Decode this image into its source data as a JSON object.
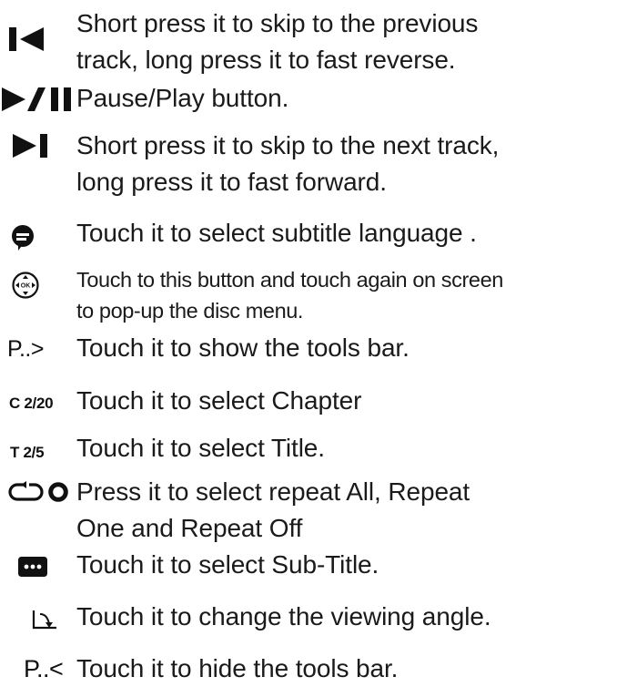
{
  "items": [
    {
      "icon": "skip-previous-icon",
      "lines": [
        "Short press it to skip to the previous",
        "track, long press it to fast reverse."
      ]
    },
    {
      "icon": "play-pause-icon",
      "lines": [
        "Pause/Play button."
      ]
    },
    {
      "icon": "skip-next-icon",
      "lines": [
        "Short press it to skip to the next track,",
        "long press it to fast forward."
      ]
    },
    {
      "icon": "subtitle-language-icon",
      "lines": [
        "Touch it to select subtitle language ."
      ]
    },
    {
      "icon": "disc-menu-icon",
      "icon_text": "OK",
      "lines": [
        "Touch to this button and touch  again on screen",
        "to pop-up the disc menu."
      ]
    },
    {
      "icon": "show-tools-bar-icon",
      "icon_text": "P..>",
      "lines": [
        "Touch it to show the tools bar."
      ]
    },
    {
      "icon": "chapter-icon",
      "icon_text": "C 2/20",
      "lines": [
        "Touch it to select Chapter"
      ]
    },
    {
      "icon": "title-icon",
      "icon_text": "T 2/5",
      "lines": [
        "Touch it to select Title."
      ]
    },
    {
      "icon": "repeat-icon",
      "lines": [
        "Press it to select repeat All, Repeat",
        "One and Repeat Off"
      ]
    },
    {
      "icon": "sub-title-icon",
      "lines": [
        "Touch it to select Sub-Title."
      ]
    },
    {
      "icon": "viewing-angle-icon",
      "lines": [
        "Touch it to change the viewing angle."
      ]
    },
    {
      "icon": "hide-tools-bar-icon",
      "icon_text": "P..<",
      "lines": [
        "Touch it to hide the tools bar."
      ]
    }
  ],
  "colors": {
    "text": "#1a1a1a",
    "icon": "#111111"
  }
}
